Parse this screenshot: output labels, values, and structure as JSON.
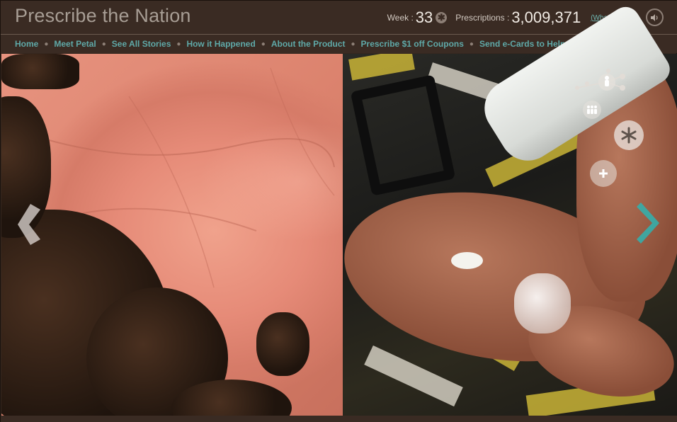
{
  "header": {
    "title": "Prescribe the Nation",
    "week_label": "Week :",
    "week_value": "33",
    "asterisk": "✱",
    "prescriptions_label": "Prescriptions :",
    "prescriptions_value": "3,009,371",
    "whats_this": "(What's this?)",
    "sound_icon": "speaker-icon"
  },
  "nav": {
    "items": [
      {
        "label": "Home"
      },
      {
        "label": "Meet Petal"
      },
      {
        "label": "See All Stories"
      },
      {
        "label": "How it Happened"
      },
      {
        "label": "About the Product"
      },
      {
        "label": "Prescribe $1 off Coupons"
      },
      {
        "label": "Send e-Cards to Help Skin Fund"
      }
    ],
    "separator": "●"
  },
  "controls": {
    "prev_icon": "chevron-left-icon",
    "next_icon": "chevron-right-icon",
    "network_icon": "person-network-icon",
    "group_icon": "group-icon",
    "asterisk_icon": "asterisk-icon",
    "plus_icon": "plus-icon"
  },
  "colors": {
    "background": "#3a2b23",
    "title": "#a79d94",
    "link": "#5fa9a8",
    "accent_teal": "#2fb3b0"
  }
}
